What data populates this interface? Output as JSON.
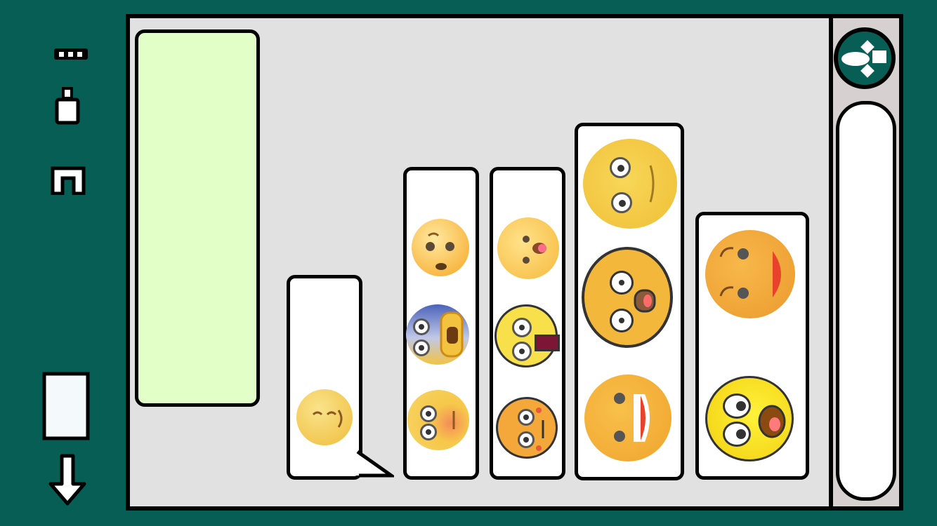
{
  "app": {
    "title": ""
  },
  "colors": {
    "frame": "#075e54",
    "canvas": "#e1e1e1",
    "sidebar": "#d6d0d0",
    "input_box": "#e1ffc7",
    "emoji_yellow": "#f3b73b"
  },
  "left_rail": {
    "icons": [
      "more-dots-icon",
      "bottle-icon",
      "magnet-icon",
      "paper-icon",
      "down-arrow-icon"
    ]
  },
  "right_rail": {
    "logo": "send-logo-icon",
    "field": "vertical-text-field"
  },
  "columns": [
    {
      "name": "column-1",
      "emojis": [
        "smiling-face"
      ]
    },
    {
      "name": "column-2",
      "emojis": [
        "flushed-face",
        "screaming-face",
        "embarrassed-face"
      ]
    },
    {
      "name": "column-3",
      "emojis": [
        "tongue-face",
        "stuck-out-tongue-face",
        "dizzy-face"
      ]
    },
    {
      "name": "column-4",
      "emojis": [
        "rolling-eyes-face",
        "glasses-surprised-face",
        "laughing-face"
      ]
    },
    {
      "name": "column-5",
      "emojis": [
        "grinning-sideways-face",
        "surprised-cartoon-face"
      ]
    }
  ]
}
